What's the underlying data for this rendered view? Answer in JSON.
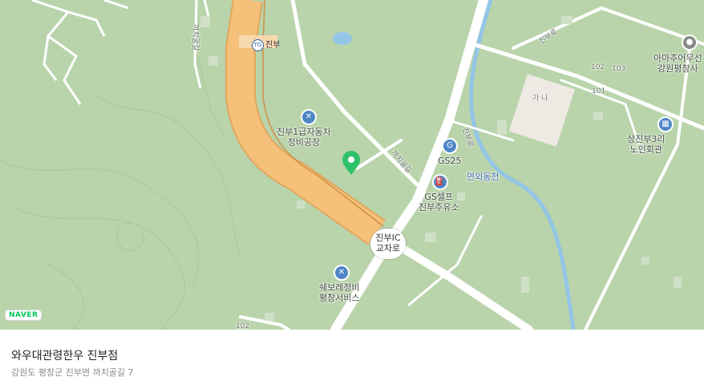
{
  "map": {
    "logo": "NAVER",
    "expressway_sign": "TG",
    "labels": [
      {
        "id": "tg",
        "text": "진부"
      },
      {
        "id": "repair1",
        "text": "진부1급자동차\n정비공장"
      },
      {
        "id": "gs25",
        "text": "GS25"
      },
      {
        "id": "gsself",
        "text": "GS셀프\n진부주유소"
      },
      {
        "id": "ic",
        "text": "진부IC\n교차로"
      },
      {
        "id": "chevy",
        "text": "쉐보레정비\n평창서비스"
      },
      {
        "id": "stream",
        "text": "면외동천"
      },
      {
        "id": "amachu",
        "text": "아마추어무선\n강원평창사"
      },
      {
        "id": "senior",
        "text": "상진부3리\n노인회관"
      },
      {
        "id": "road1",
        "text": "까치골길"
      },
      {
        "id": "road2",
        "text": "까치골길"
      },
      {
        "id": "road3",
        "text": "진부로"
      },
      {
        "id": "road4",
        "text": "진부로"
      },
      {
        "id": "n102a",
        "text": "102"
      },
      {
        "id": "n103",
        "text": "103"
      },
      {
        "id": "n101",
        "text": "101"
      },
      {
        "id": "n102b",
        "text": "102"
      },
      {
        "id": "bldg",
        "text": "가 나"
      }
    ],
    "colors": {
      "land": "#b9d4ab",
      "road": "#ffffff",
      "highway": "#f5c079",
      "water": "#93c5e6",
      "marker": "#2fc16a",
      "poi": "#4f86c6"
    }
  },
  "place": {
    "name": "와우대관령한우 진부점",
    "address": "강원도 평창군 진부면 까치골길 7"
  }
}
